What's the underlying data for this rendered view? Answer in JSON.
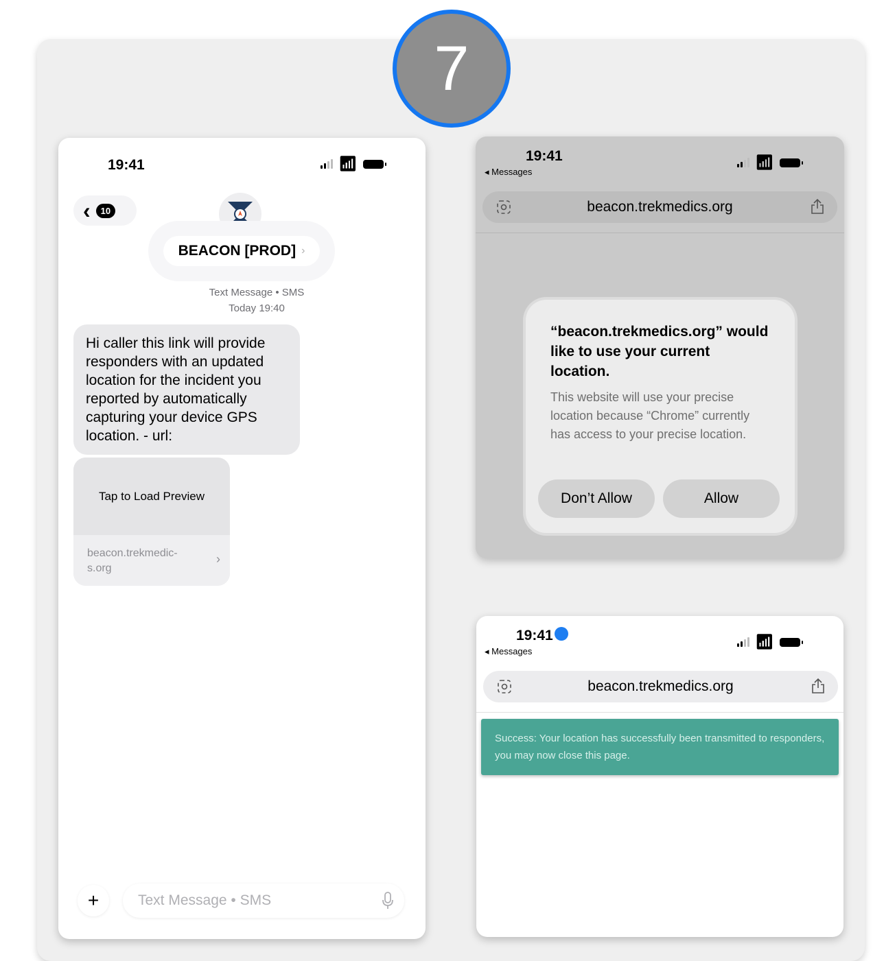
{
  "step": {
    "number": "7"
  },
  "colors": {
    "step_ring": "#1577f0",
    "step_fill": "#8e8e8e",
    "success_bg": "#4aa595",
    "nav_badge": "#1e7ef1"
  },
  "messages_screen": {
    "status_time": "19:41",
    "back_count": "10",
    "contact_name": "BEACON [PROD]",
    "meta_line_1": "Text Message • SMS",
    "meta_line_2": "Today 19:40",
    "message_text": "Hi caller this link will provide responders with an updated location for the incident you reported by automatically capturing your device GPS location. - url:",
    "preview": {
      "tap_label": "Tap to Load Preview",
      "domain": "beacon.trekmedic-\ns.org"
    },
    "compose_placeholder": "Text Message • SMS",
    "icons": [
      "chevron-left-icon",
      "compass-icon",
      "plus-icon",
      "microphone-icon",
      "chevron-right-icon"
    ]
  },
  "permission_screen": {
    "status_time": "19:41",
    "back_app": "◂ Messages",
    "url": "beacon.trekmedics.org",
    "alert": {
      "title": "“beacon.trekmedics.org” would like to use your current location.",
      "body": "This website will use your precise location because “Chrome” currently has access to your precise location.",
      "dont_allow": "Don’t Allow",
      "allow": "Allow"
    }
  },
  "success_screen": {
    "status_time": "19:41",
    "back_app": "◂ Messages",
    "url": "beacon.trekmedics.org",
    "success_message": "Success: Your location has successfully been transmitted to responders, you may now close this page."
  }
}
